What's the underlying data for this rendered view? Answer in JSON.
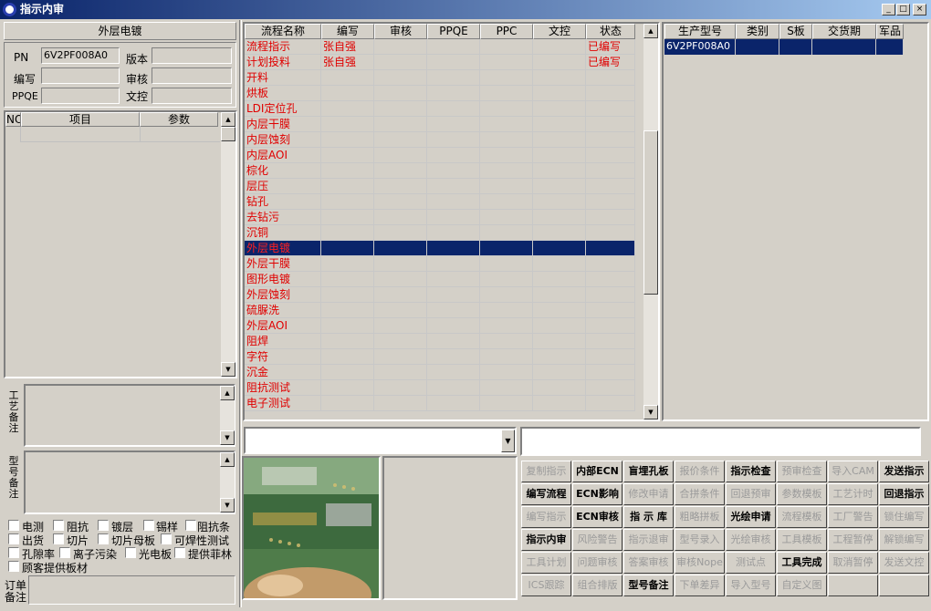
{
  "window": {
    "title": "指示内审",
    "min": "_",
    "max": "□",
    "close": "×"
  },
  "left": {
    "section_title": "外层电镀",
    "pn_label": "PN",
    "pn_value": "6V2PF008A0",
    "version_label": "版本",
    "version_value": "",
    "author_label": "编写",
    "author_value": "",
    "review_label": "审核",
    "review_value": "",
    "ppqe_label": "PPQE",
    "ppqe_value": "",
    "doc_label": "文控",
    "doc_value": "",
    "param_headers": [
      "NO",
      "项目",
      "参数"
    ],
    "craft_note_label": "工艺备注",
    "model_note_label": "型号备注",
    "order_note_label": "订单备注",
    "checkboxes": [
      [
        "电测",
        "阻抗",
        "镀层",
        "锡样",
        "阻抗条"
      ],
      [
        "出货",
        "切片",
        "切片母板",
        "可焊性测试"
      ],
      [
        "孔隙率",
        "离子污染",
        "光电板",
        "提供菲林"
      ],
      [
        "顾客提供板材"
      ]
    ]
  },
  "process": {
    "headers": [
      "流程名称",
      "编写",
      "审核",
      "PPQE",
      "PPC",
      "文控",
      "状态"
    ],
    "rows": [
      {
        "name": "流程指示",
        "author": "张自强",
        "status": "已编写"
      },
      {
        "name": "计划投料",
        "author": "张自强",
        "status": "已编写"
      },
      {
        "name": "开料",
        "author": "",
        "status": ""
      },
      {
        "name": "烘板",
        "author": "",
        "status": ""
      },
      {
        "name": "LDI定位孔",
        "author": "",
        "status": ""
      },
      {
        "name": "内层干膜",
        "author": "",
        "status": ""
      },
      {
        "name": "内层蚀刻",
        "author": "",
        "status": ""
      },
      {
        "name": "内层AOI",
        "author": "",
        "status": ""
      },
      {
        "name": "棕化",
        "author": "",
        "status": ""
      },
      {
        "name": "层压",
        "author": "",
        "status": ""
      },
      {
        "name": "钻孔",
        "author": "",
        "status": ""
      },
      {
        "name": "去钻污",
        "author": "",
        "status": ""
      },
      {
        "name": "沉铜",
        "author": "",
        "status": ""
      },
      {
        "name": "外层电镀",
        "author": "",
        "status": "",
        "selected": true
      },
      {
        "name": "外层干膜",
        "author": "",
        "status": ""
      },
      {
        "name": "图形电镀",
        "author": "",
        "status": ""
      },
      {
        "name": "外层蚀刻",
        "author": "",
        "status": ""
      },
      {
        "name": "硫脲洗",
        "author": "",
        "status": ""
      },
      {
        "name": "外层AOI",
        "author": "",
        "status": ""
      },
      {
        "name": "阻焊",
        "author": "",
        "status": ""
      },
      {
        "name": "字符",
        "author": "",
        "status": ""
      },
      {
        "name": "沉金",
        "author": "",
        "status": ""
      },
      {
        "name": "阻抗测试",
        "author": "",
        "status": ""
      },
      {
        "name": "电子测试",
        "author": "",
        "status": ""
      }
    ]
  },
  "model_grid": {
    "headers": [
      "生产型号",
      "类别",
      "S板",
      "交货期",
      "军品"
    ],
    "rows": [
      [
        "6V2PF008A0",
        "",
        "",
        "",
        ""
      ]
    ]
  },
  "buttons": [
    [
      [
        "复制指示",
        "dis"
      ],
      [
        "内部ECN",
        "en"
      ],
      [
        "盲埋孔板",
        "en"
      ],
      [
        "报价条件",
        "dis"
      ],
      [
        "指示检查",
        "en"
      ],
      [
        "预审检查",
        "dis"
      ],
      [
        "导入CAM",
        "dis"
      ],
      [
        "发送指示",
        "en"
      ]
    ],
    [
      [
        "编写流程",
        "en"
      ],
      [
        "ECN影响",
        "en"
      ],
      [
        "修改申请",
        "dis"
      ],
      [
        "合拼条件",
        "dis"
      ],
      [
        "回退预审",
        "dis"
      ],
      [
        "参数模板",
        "dis"
      ],
      [
        "工艺计时",
        "dis"
      ],
      [
        "回退指示",
        "en"
      ]
    ],
    [
      [
        "编写指示",
        "dis"
      ],
      [
        "ECN审核",
        "en"
      ],
      [
        "指 示 库",
        "en"
      ],
      [
        "粗略拼板",
        "dis"
      ],
      [
        "光绘申请",
        "en"
      ],
      [
        "流程模板",
        "dis"
      ],
      [
        "工厂警告",
        "dis"
      ],
      [
        "锁住编写",
        "dis"
      ]
    ],
    [
      [
        "指示内审",
        "en"
      ],
      [
        "风险警告",
        "dis"
      ],
      [
        "指示退审",
        "dis"
      ],
      [
        "型号录入",
        "dis"
      ],
      [
        "光绘审核",
        "dis"
      ],
      [
        "工具模板",
        "dis"
      ],
      [
        "工程暂停",
        "dis"
      ],
      [
        "解锁编写",
        "dis"
      ]
    ],
    [
      [
        "工具计划",
        "dis"
      ],
      [
        "问题审核",
        "dis"
      ],
      [
        "答案审核",
        "dis"
      ],
      [
        "审核Nope",
        "dis"
      ],
      [
        "测试点",
        "dis"
      ],
      [
        "工具完成",
        "en"
      ],
      [
        "取消暂停",
        "dis"
      ],
      [
        "发送文控",
        "dis"
      ]
    ],
    [
      [
        "ICS跟踪",
        "dis"
      ],
      [
        "组合排版",
        "dis"
      ],
      [
        "型号备注",
        "en"
      ],
      [
        "下单差异",
        "dis"
      ],
      [
        "导入型号",
        "dis"
      ],
      [
        "自定义图",
        "dis"
      ],
      [
        "",
        ""
      ],
      [
        "",
        ""
      ]
    ]
  ],
  "colors": {
    "title_bg": "#0a246a",
    "selection": "#0a246a",
    "status_text": "#e00000"
  },
  "icons": {
    "app": "app-icon",
    "scroll_up": "up-arrow-icon",
    "scroll_down": "down-arrow-icon",
    "dropdown": "dropdown-arrow-icon"
  }
}
